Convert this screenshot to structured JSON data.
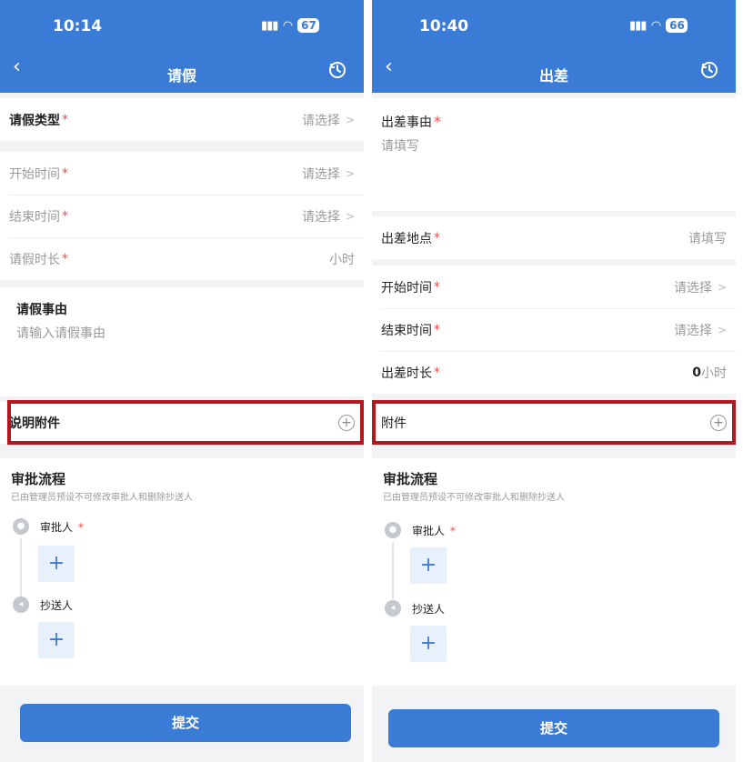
{
  "left": {
    "status": {
      "time": "10:14",
      "battery": "67"
    },
    "nav": {
      "title": "请假"
    },
    "form": {
      "leave_type": {
        "label": "请假类型",
        "required": "*",
        "value": "请选择",
        "chevron": ">"
      },
      "start_time": {
        "label": "开始时间",
        "required": "*",
        "value": "请选择",
        "chevron": ">"
      },
      "end_time": {
        "label": "结束时间",
        "required": "*",
        "value": "请选择",
        "chevron": ">"
      },
      "duration": {
        "label": "请假时长",
        "required": "*",
        "value": "小时"
      },
      "reason": {
        "label": "请假事由",
        "placeholder": "请输入请假事由"
      },
      "attachment": {
        "label": "说明附件",
        "plus": "+"
      }
    },
    "approval": {
      "title": "审批流程",
      "hint": "已由管理员预设不可修改审批人和删除抄送人",
      "approver": {
        "label": "审批人",
        "required": "*"
      },
      "cc": {
        "label": "抄送人"
      },
      "add": "+"
    },
    "submit": "提交"
  },
  "right": {
    "status": {
      "time": "10:40",
      "battery": "66"
    },
    "nav": {
      "title": "出差"
    },
    "form": {
      "reason": {
        "label": "出差事由",
        "required": "*",
        "placeholder": "请填写"
      },
      "location": {
        "label": "出差地点",
        "required": "*",
        "value": "请填写"
      },
      "start_time": {
        "label": "开始时间",
        "required": "*",
        "value": "请选择",
        "chevron": ">"
      },
      "end_time": {
        "label": "结束时间",
        "required": "*",
        "value": "请选择",
        "chevron": ">"
      },
      "duration": {
        "label": "出差时长",
        "required": "*",
        "value_number": "0",
        "value_unit": "小时"
      },
      "attachment": {
        "label": "附件",
        "plus": "+"
      }
    },
    "approval": {
      "title": "审批流程",
      "hint": "已由管理员预设不可修改审批人和删除抄送人",
      "approver": {
        "label": "审批人",
        "required": "*"
      },
      "cc": {
        "label": "抄送人"
      },
      "add": "+"
    },
    "submit": "提交"
  },
  "colors": {
    "brand": "#3a7bd5",
    "required": "#ec4c4c",
    "highlight": "#b5171e"
  },
  "icons": {
    "back": "chevron-left-icon",
    "history": "clock-history-icon",
    "signal": "signal-icon",
    "wifi": "wifi-icon",
    "add": "plus-icon"
  }
}
